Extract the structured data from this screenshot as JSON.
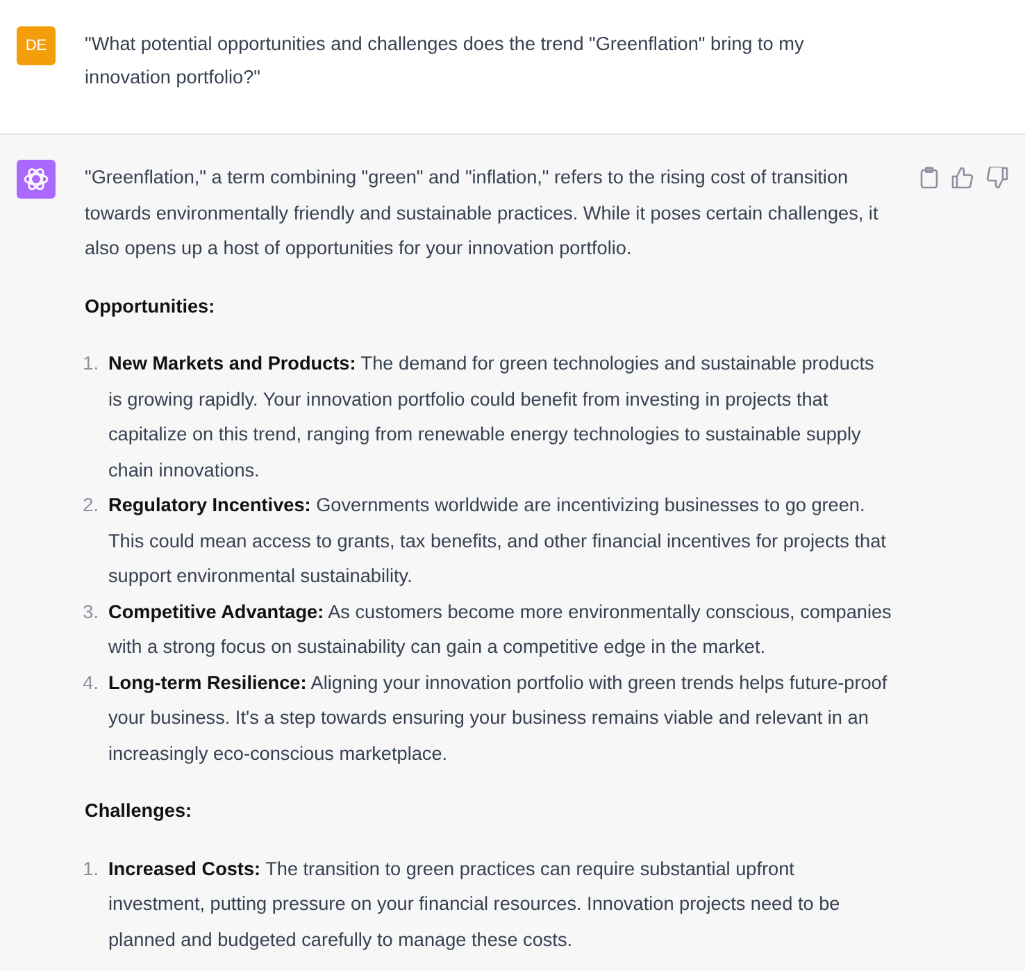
{
  "user_message": {
    "avatar": "DE",
    "text": "\"What potential opportunities and challenges does the trend \"Greenflation\" bring to my innovation portfolio?\""
  },
  "assistant_message": {
    "intro": "\"Greenflation,\" a term combining \"green\" and \"inflation,\" refers to the rising cost of transition towards environmentally friendly and sustainable practices. While it poses certain challenges, it also opens up a host of opportunities for your innovation portfolio.",
    "sections": [
      {
        "heading": "Opportunities:",
        "items": [
          {
            "number": "1.",
            "text": "**New Markets and Products:** The demand for green technologies and sustainable products is growing rapidly. Your innovation portfolio could benefit from investing in projects that capitalize on this trend, ranging from renewable energy technologies to sustainable supply chain innovations."
          },
          {
            "number": "2.",
            "text": "**Regulatory Incentives:** Governments worldwide are incentivizing businesses to go green. This could mean access to grants, tax benefits, and other financial incentives for projects that support environmental sustainability."
          },
          {
            "number": "3.",
            "text": "**Competitive Advantage:** As customers become more environmentally conscious, companies with a strong focus on sustainability can gain a competitive edge in the market."
          },
          {
            "number": "4.",
            "text": "**Long-term Resilience:** Aligning your innovation portfolio with green trends helps future-proof your business. It's a step towards ensuring your business remains viable and relevant in an increasingly eco-conscious marketplace."
          }
        ]
      },
      {
        "heading": "Challenges:",
        "items": [
          {
            "number": "1.",
            "text": "**Increased Costs:** The transition to green practices can require substantial upfront investment, putting pressure on your financial resources. Innovation projects need to be planned and budgeted carefully to manage these costs."
          }
        ]
      }
    ]
  }
}
